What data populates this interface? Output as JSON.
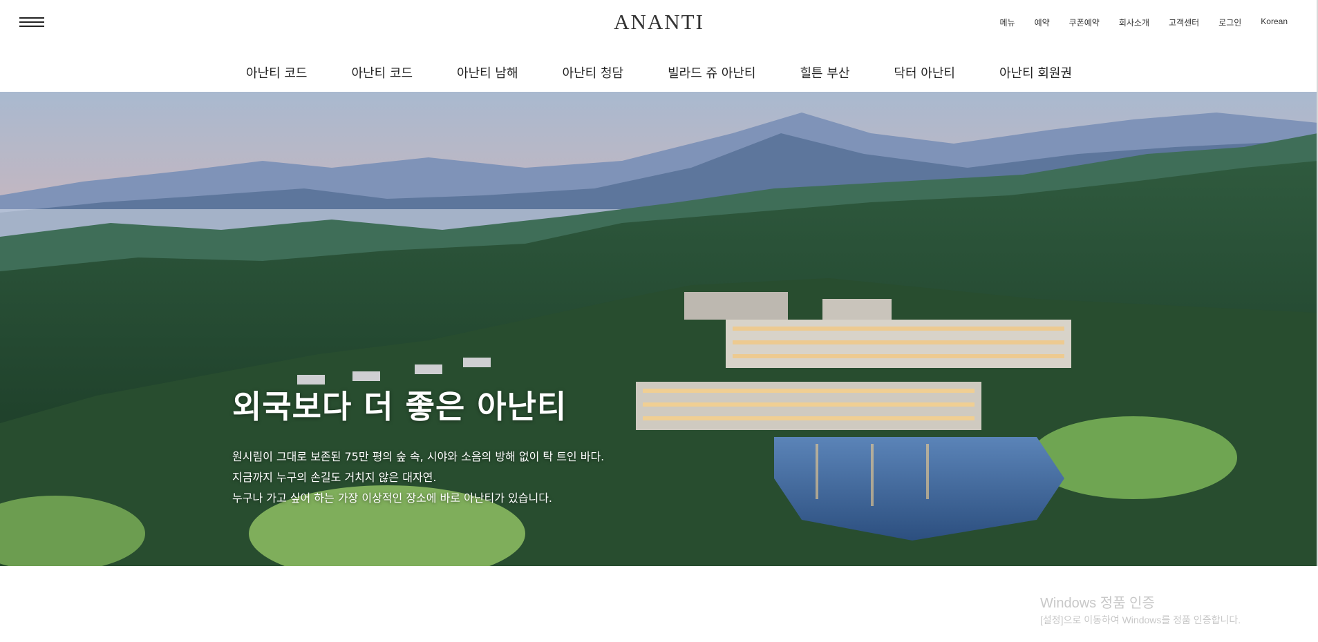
{
  "header": {
    "logo": "ANANTI",
    "menu_icon": "hamburger-menu-icon",
    "util_links": [
      "메뉴",
      "예약",
      "쿠폰예약",
      "회사소개",
      "고객센터",
      "로그인",
      "Korean"
    ]
  },
  "gnb": {
    "items": [
      "아난티 코드",
      "아난티 코드",
      "아난티 남해",
      "아난티 청담",
      "빌라드 쥬 아난티",
      "힐튼 부산",
      "닥터 아난티",
      "아난티 회원권"
    ]
  },
  "hero": {
    "title": "외국보다 더 좋은 아난티",
    "lines": [
      "원시림이 그대로 보존된 75만 평의 숲 속, 시야와 소음의 방해 없이 탁 트인 바다.",
      "지금까지 누구의 손길도 거치지 않은 대자연.",
      "누구나 가고 싶어 하는 가장 이상적인 장소에 바로 아난티가 있습니다."
    ]
  },
  "watermark": {
    "title": "Windows 정품 인증",
    "subtitle": "[설정]으로 이동하여 Windows를 정품 인증합니다."
  }
}
